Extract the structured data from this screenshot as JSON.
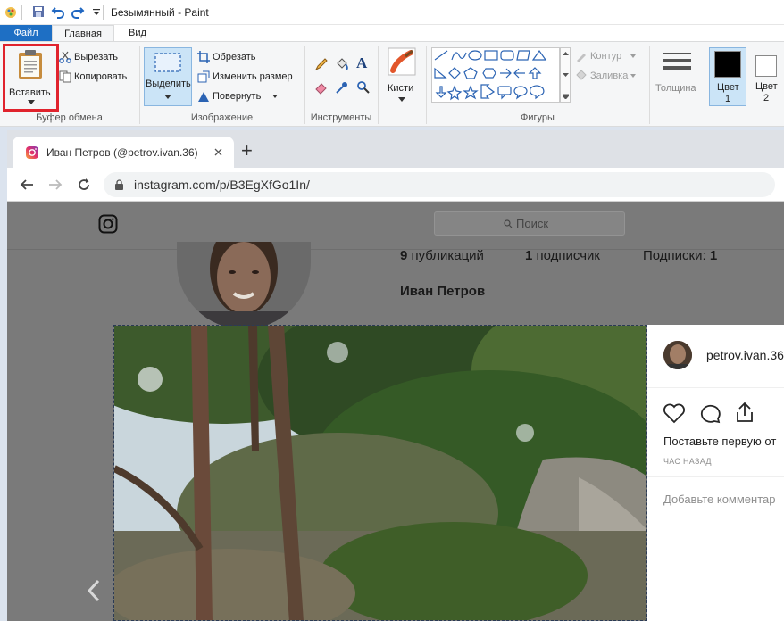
{
  "paint": {
    "window_title": "Безымянный - Paint",
    "tabs": [
      "Файл",
      "Главная",
      "Вид"
    ],
    "clipboard": {
      "paste_label": "Вставить",
      "cut_label": "Вырезать",
      "copy_label": "Копировать",
      "group_label": "Буфер обмена"
    },
    "image": {
      "select_label": "Выделить",
      "crop_label": "Обрезать",
      "resize_label": "Изменить размер",
      "rotate_label": "Повернуть",
      "group_label": "Изображение"
    },
    "tools": {
      "group_label": "Инструменты"
    },
    "brushes_label": "Кисти",
    "shapes": {
      "outline_label": "Контур",
      "fill_label": "Заливка",
      "group_label": "Фигуры"
    },
    "size_label": "Толщина",
    "color1_label": "Цвет",
    "color1_num": "1",
    "color2_label": "Цвет",
    "color2_num": "2",
    "accent_color": "#e0232d"
  },
  "browser": {
    "tab_title": "Иван Петров (@petrov.ivan.36)",
    "new_tab": "+",
    "url": "instagram.com/p/B3EgXfGo1In/"
  },
  "instagram": {
    "search_placeholder": "Поиск",
    "posts_count": "9",
    "posts_label": "публикаций",
    "followers_count": "1",
    "followers_label": "подписчик",
    "following_label": "Подписки:",
    "following_count": "1",
    "profile_name": "Иван Петров",
    "post_username": "petrov.ivan.36",
    "like_prompt": "Поставьте первую от",
    "timestamp": "ЧАС НАЗАД",
    "comment_placeholder": "Добавьте комментар"
  }
}
